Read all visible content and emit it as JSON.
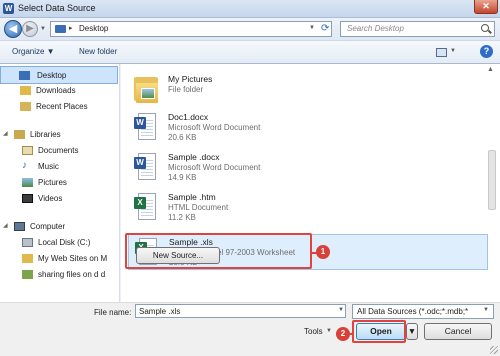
{
  "window": {
    "title": "Select Data Source",
    "app_icon": "W",
    "close_label": "✕"
  },
  "nav": {
    "back": "◀",
    "forward": "▶",
    "address": "Desktop",
    "search_placeholder": "Search Desktop"
  },
  "toolbar": {
    "organize": "Organize ▼",
    "new_folder": "New folder",
    "help": "?"
  },
  "sidebar": {
    "items": [
      {
        "label": "Desktop",
        "icon": "desktop-icon"
      },
      {
        "label": "Downloads",
        "icon": "downloads-icon"
      },
      {
        "label": "Recent Places",
        "icon": "recent-places-icon"
      },
      {
        "label": "Libraries",
        "icon": "libraries-icon"
      },
      {
        "label": "Documents",
        "icon": "documents-icon"
      },
      {
        "label": "Music",
        "icon": "music-icon"
      },
      {
        "label": "Pictures",
        "icon": "pictures-icon"
      },
      {
        "label": "Videos",
        "icon": "videos-icon"
      },
      {
        "label": "Computer",
        "icon": "computer-icon"
      },
      {
        "label": "Local Disk (C:)",
        "icon": "disk-icon"
      },
      {
        "label": "My Web Sites on M",
        "icon": "web-sites-icon"
      },
      {
        "label": "sharing files on d d",
        "icon": "network-folder-icon"
      }
    ]
  },
  "files": [
    {
      "name": "My Pictures",
      "type": "File folder",
      "size": ""
    },
    {
      "name": "Doc1.docx",
      "type": "Microsoft Word Document",
      "size": "20.6 KB"
    },
    {
      "name": "Sample .docx",
      "type": "Microsoft Word Document",
      "size": "14.9 KB"
    },
    {
      "name": "Sample .htm",
      "type": "HTML Document",
      "size": "11.2 KB"
    },
    {
      "name": "Sample .xls",
      "type": "Microsoft Excel 97-2003 Worksheet",
      "size": "28.0 KB"
    }
  ],
  "callouts": {
    "one": "1",
    "two": "2"
  },
  "new_source": "New Source...",
  "footer": {
    "file_name_label": "File name:",
    "file_name_value": "Sample .xls",
    "filter": "All Data Sources (*.odc;*.mdb;*",
    "tools": "Tools",
    "open": "Open",
    "cancel": "Cancel"
  },
  "colors": {
    "highlight": "#e0443e",
    "selection": "#cde4fb"
  }
}
